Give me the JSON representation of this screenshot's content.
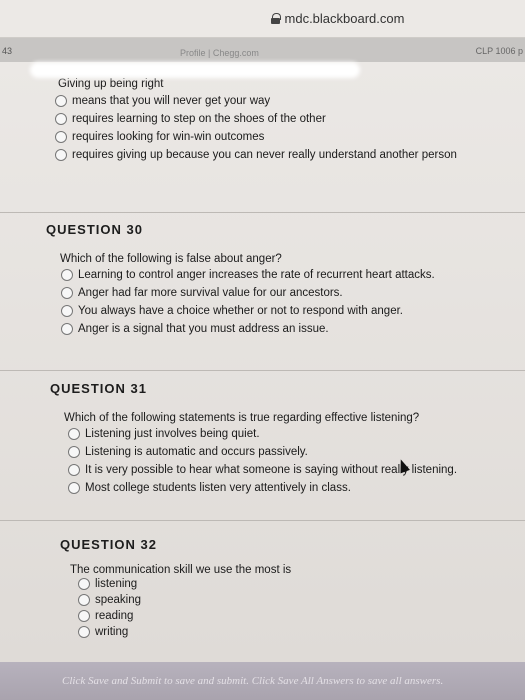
{
  "browser": {
    "url": "mdc.blackboard.com"
  },
  "tabs": {
    "left_number": "43",
    "site": "Profile | Chegg.com",
    "course": "CLP 1006 p"
  },
  "previous_question": {
    "prompt": "Giving up being right",
    "options": [
      "means that you will never get your way",
      "requires learning to step on the shoes of the other",
      "requires looking for win-win outcomes",
      "requires giving up because you can never really understand another person"
    ]
  },
  "q30": {
    "heading": "QUESTION 30",
    "prompt": "Which of the following is false about anger?",
    "options": [
      "Learning to control anger increases the rate of recurrent heart attacks.",
      "Anger had far more survival value for our ancestors.",
      "You always have a choice whether or not to respond with anger.",
      "Anger is a signal that you must address an issue."
    ]
  },
  "q31": {
    "heading": "QUESTION 31",
    "prompt": "Which of the following statements is true regarding effective listening?",
    "options": [
      "Listening just involves being quiet.",
      "Listening is automatic and occurs passively.",
      "It is very possible to hear what someone is saying without really listening.",
      "Most college students listen very attentively in class."
    ]
  },
  "q32": {
    "heading": "QUESTION 32",
    "prompt": "The communication skill we use the most is",
    "options": [
      "listening",
      "speaking",
      "reading",
      "writing"
    ]
  },
  "footer": {
    "text": "Click Save and Submit to save and submit. Click Save All Answers to save all answers."
  }
}
